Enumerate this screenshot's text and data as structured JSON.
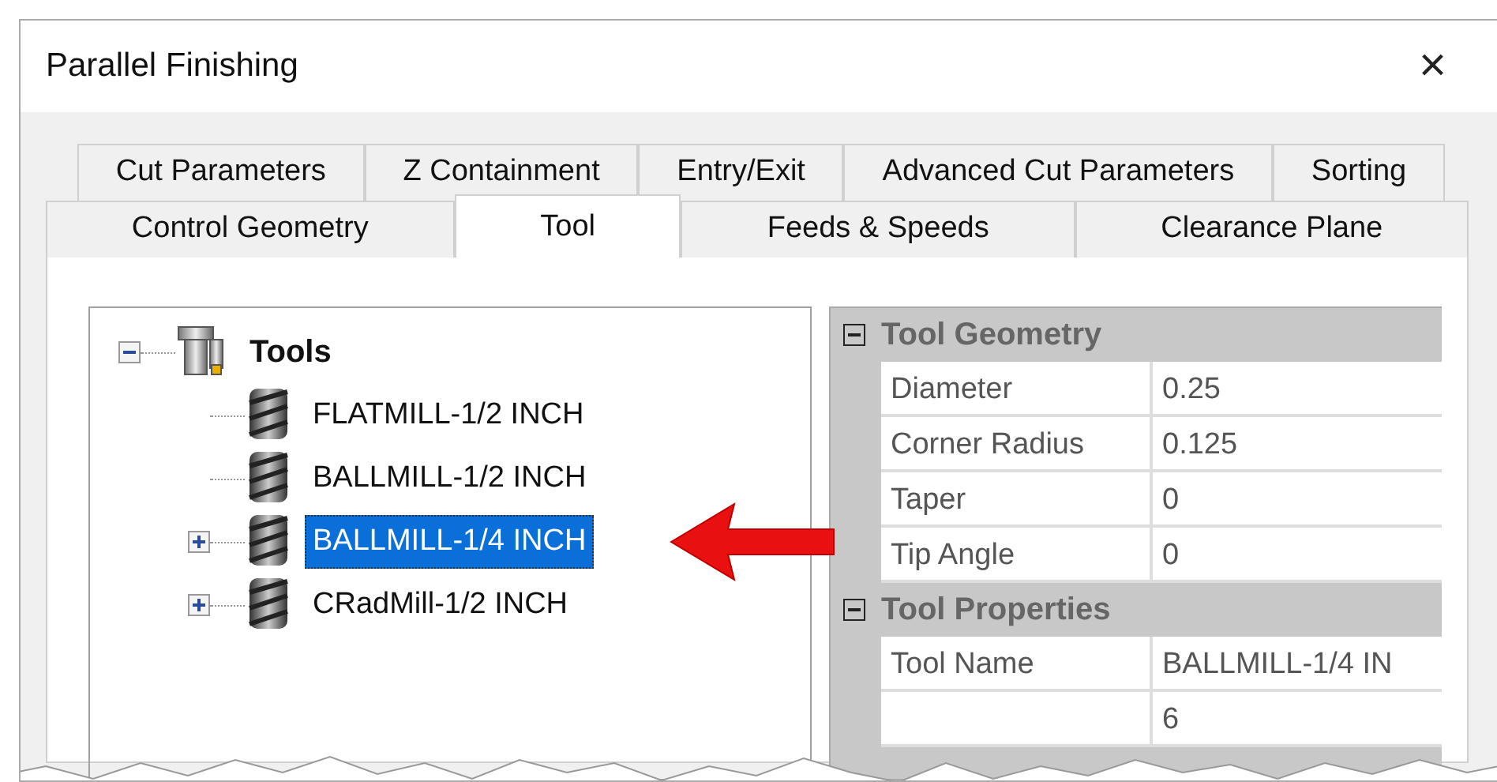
{
  "window": {
    "title": "Parallel Finishing",
    "close": "×"
  },
  "tab_rows": [
    [
      {
        "label": "Cut Parameters",
        "selected": false
      },
      {
        "label": "Z Containment",
        "selected": false
      },
      {
        "label": "Entry/Exit",
        "selected": false
      },
      {
        "label": "Advanced Cut Parameters",
        "selected": false
      },
      {
        "label": "Sorting",
        "selected": false
      }
    ],
    [
      {
        "label": "Control Geometry",
        "selected": false
      },
      {
        "label": "Tool",
        "selected": true
      },
      {
        "label": "Feeds & Speeds",
        "selected": false
      },
      {
        "label": "Clearance Plane",
        "selected": false
      }
    ]
  ],
  "tree": {
    "label": "Tools",
    "expanded": true,
    "children": [
      {
        "label": "FLATMILL-1/2 INCH",
        "expandable": false,
        "selected": false
      },
      {
        "label": "BALLMILL-1/2 INCH",
        "expandable": false,
        "selected": false
      },
      {
        "label": "BALLMILL-1/4 INCH",
        "expandable": true,
        "selected": true
      },
      {
        "label": "CRadMill-1/2 INCH",
        "expandable": true,
        "selected": false
      }
    ]
  },
  "property_grid": [
    {
      "category": "Tool Geometry",
      "expanded": true,
      "rows": [
        {
          "name": "Diameter",
          "value": "0.25"
        },
        {
          "name": "Corner Radius",
          "value": "0.125"
        },
        {
          "name": "Taper",
          "value": "0"
        },
        {
          "name": "Tip Angle",
          "value": "0"
        }
      ]
    },
    {
      "category": "Tool Properties",
      "expanded": true,
      "rows": [
        {
          "name": "Tool Name",
          "value": "BALLMILL-1/4 IN"
        },
        {
          "value": "6"
        }
      ]
    }
  ]
}
